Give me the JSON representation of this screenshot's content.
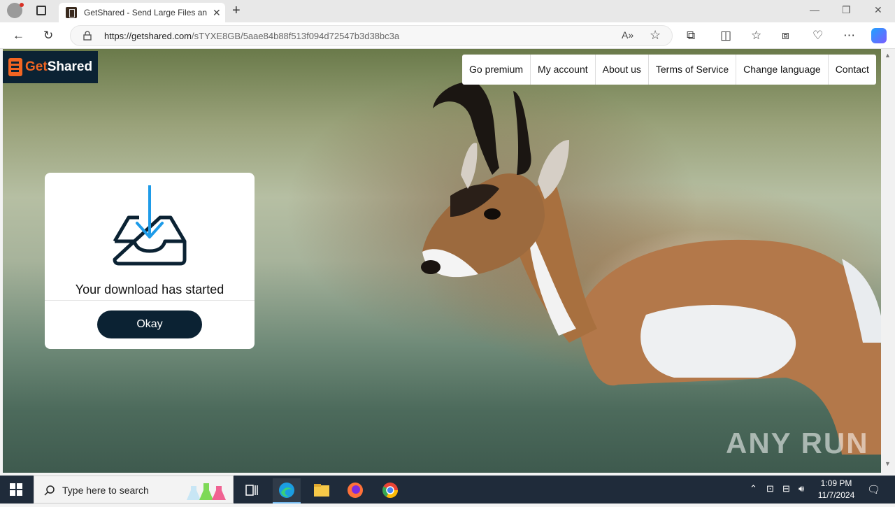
{
  "browser": {
    "tab_title": "GetShared - Send Large Files and",
    "url_host": "https://getshared.com",
    "url_path": "/sTYXE8GB/5aae84b88f513f094d72547b3d38bc3a"
  },
  "site": {
    "logo_get": "Get",
    "logo_shared": "Shared",
    "nav": [
      "Go premium",
      "My account",
      "About us",
      "Terms of Service",
      "Change language",
      "Contact"
    ]
  },
  "dialog": {
    "message": "Your download has started",
    "ok_label": "Okay"
  },
  "watermark": "ANY RUN",
  "taskbar": {
    "search_placeholder": "Type here to search",
    "time": "1:09 PM",
    "date": "11/7/2024"
  },
  "colors": {
    "brand_dark": "#0b2233",
    "brand_orange": "#f26522",
    "download_blue": "#1e9be8"
  }
}
